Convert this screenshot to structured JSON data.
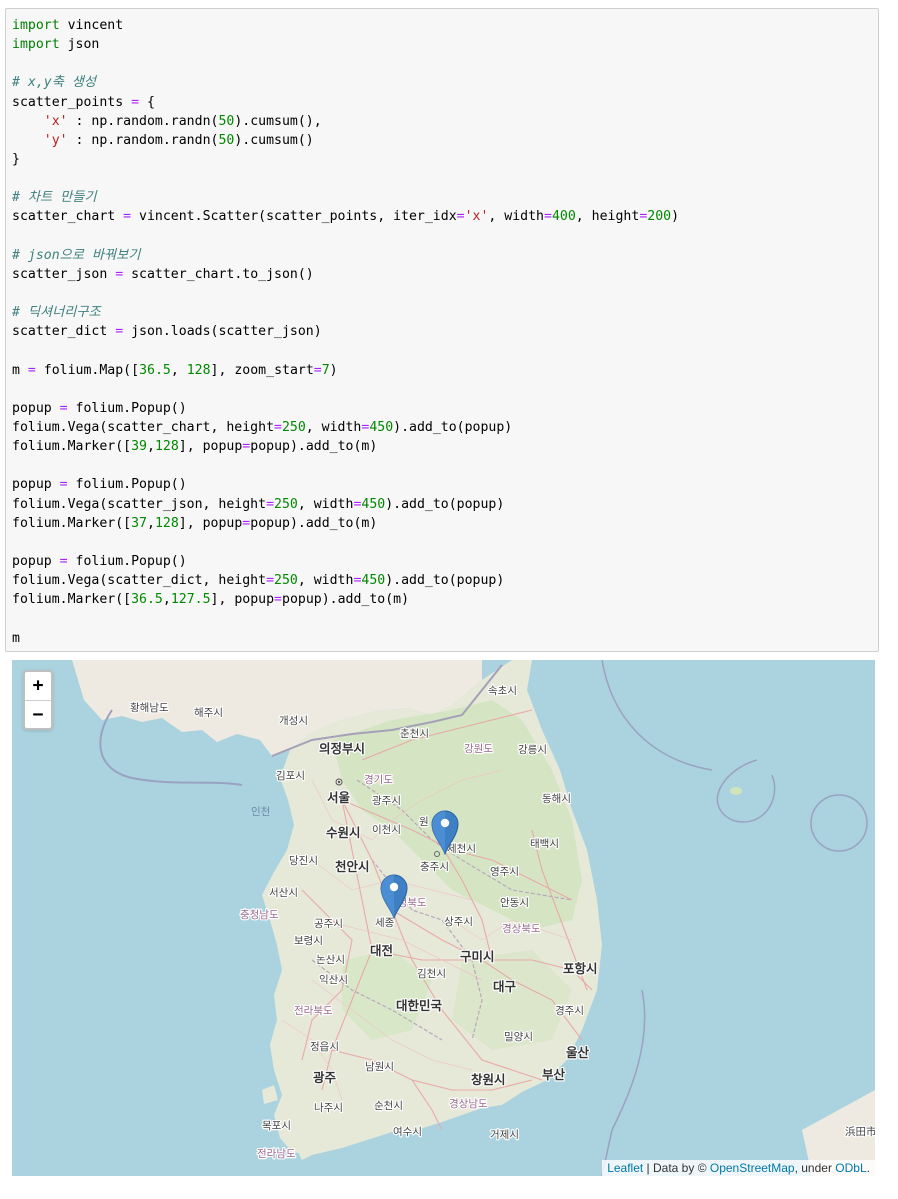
{
  "code": {
    "line_01": "import vincent",
    "line_02": "import json",
    "line_04": "# x,y축 생성",
    "line_05": "scatter_points = {",
    "line_06": "    'x' : np.random.randn(50).cumsum(),",
    "line_07": "    'y' : np.random.randn(50).cumsum()",
    "line_08": "}",
    "line_10": "# 차트 만들기",
    "line_11": "scatter_chart = vincent.Scatter(scatter_points, iter_idx='x', width=400, height=200)",
    "line_13": "# json으로 바꿔보기",
    "line_14": "scatter_json = scatter_chart.to_json()",
    "line_16": "# 딕셔너리구조",
    "line_17": "scatter_dict = json.loads(scatter_json)",
    "line_19": "m = folium.Map([36.5, 128], zoom_start=7)",
    "line_21": "popup = folium.Popup()",
    "line_22": "folium.Vega(scatter_chart, height=250, width=450).add_to(popup)",
    "line_23": "folium.Marker([39,128], popup=popup).add_to(m)",
    "line_25": "popup = folium.Popup()",
    "line_26": "folium.Vega(scatter_json, height=250, width=450).add_to(popup)",
    "line_27": "folium.Marker([37,128], popup=popup).add_to(m)",
    "line_29": "popup = folium.Popup()",
    "line_30": "folium.Vega(scatter_dict, height=250, width=450).add_to(popup)",
    "line_31": "folium.Marker([36.5,127.5], popup=popup).add_to(m)",
    "line_33": "m"
  },
  "map": {
    "zoom_in": "+",
    "zoom_out": "−",
    "attribution": {
      "leaflet": "Leaflet",
      "data_by": " | Data by © ",
      "osm": "OpenStreetMap",
      "under": ", under ",
      "odbl": "ODbL",
      "end": "."
    },
    "labels": {
      "hwanghae": "황해남도",
      "haeju": "해주시",
      "gaeseong": "개성시",
      "sokcho": "속초시",
      "chuncheon": "춘천시",
      "gangwon": "강원도",
      "gangneung": "강릉시",
      "uijeongbu": "의정부시",
      "gimpo": "김포시",
      "gyeonggi": "경기도",
      "seoul": "서울",
      "gwangju_gg": "광주시",
      "incheon": "인천",
      "suwon": "수원시",
      "icheon": "이천시",
      "won": "원",
      "jecheon": "제천시",
      "donghae": "동해시",
      "taebaek": "태백시",
      "dangjin": "당진시",
      "cheonan": "천안시",
      "chungju": "충주시",
      "yeongju": "영주시",
      "seosan": "서산시",
      "chungbuk": "충청북도",
      "chungnam": "충청남도",
      "gongju": "공주시",
      "sejong": "세종",
      "sangju": "상주시",
      "andong": "안동시",
      "gyeongbuk": "경상북도",
      "boryeong": "보령시",
      "daejeon": "대전",
      "nonsan": "논산시",
      "gumi": "구미시",
      "gimcheon": "김천시",
      "pohang": "포항시",
      "iksan": "익산시",
      "daegu": "대구",
      "jeonbuk": "전라북도",
      "korea": "대한민국",
      "gyeongju": "경주시",
      "miryang": "밀양시",
      "jeongeup": "정읍시",
      "namwon": "남원시",
      "ulsan": "울산",
      "gwangju": "광주",
      "changwon": "창원시",
      "busan": "부산",
      "naju": "나주시",
      "suncheon": "순천시",
      "gyeongnam": "경상남도",
      "mokpo": "목포시",
      "yeosu": "여수시",
      "geoje": "거제시",
      "jeonnam": "전라남도",
      "hamada": "浜田市"
    }
  }
}
